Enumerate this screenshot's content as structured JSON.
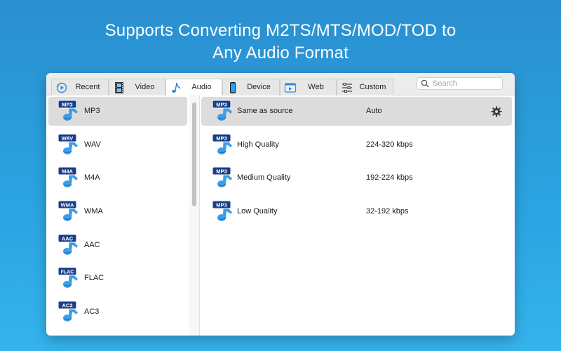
{
  "headline": {
    "line1": "Supports Converting M2TS/MTS/MOD/TOD to",
    "line2": "Any Audio Format"
  },
  "tabs": [
    {
      "label": "Recent",
      "icon": "clock-play-icon",
      "active": false
    },
    {
      "label": "Video",
      "icon": "film-strip-icon",
      "active": false
    },
    {
      "label": "Audio",
      "icon": "music-note-icon",
      "active": true
    },
    {
      "label": "Device",
      "icon": "phone-icon",
      "active": false
    },
    {
      "label": "Web",
      "icon": "web-player-icon",
      "active": false
    },
    {
      "label": "Custom",
      "icon": "sliders-icon",
      "active": false
    }
  ],
  "search": {
    "placeholder": "Search",
    "value": ""
  },
  "formats": [
    {
      "label": "MP3",
      "badge": "MP3",
      "selected": true
    },
    {
      "label": "WAV",
      "badge": "WAV",
      "selected": false
    },
    {
      "label": "M4A",
      "badge": "M4A",
      "selected": false
    },
    {
      "label": "WMA",
      "badge": "WMA",
      "selected": false
    },
    {
      "label": "AAC",
      "badge": "AAC",
      "selected": false
    },
    {
      "label": "FLAC",
      "badge": "FLAC",
      "selected": false
    },
    {
      "label": "AC3",
      "badge": "AC3",
      "selected": false
    }
  ],
  "presets": [
    {
      "name": "Same as source",
      "bitrate": "Auto",
      "badge": "MP3",
      "selected": true
    },
    {
      "name": "High Quality",
      "bitrate": "224-320 kbps",
      "badge": "MP3",
      "selected": false
    },
    {
      "name": "Medium Quality",
      "bitrate": "192-224 kbps",
      "badge": "MP3",
      "selected": false
    },
    {
      "name": "Low Quality",
      "bitrate": "32-192 kbps",
      "badge": "MP3",
      "selected": false
    }
  ],
  "colors": {
    "background_top": "#2b8fd0",
    "background_bottom": "#35b3ec",
    "selected_row": "#dcdcdc",
    "icon_blue": "#1f6fc4",
    "icon_badge": "#1b3f86"
  }
}
